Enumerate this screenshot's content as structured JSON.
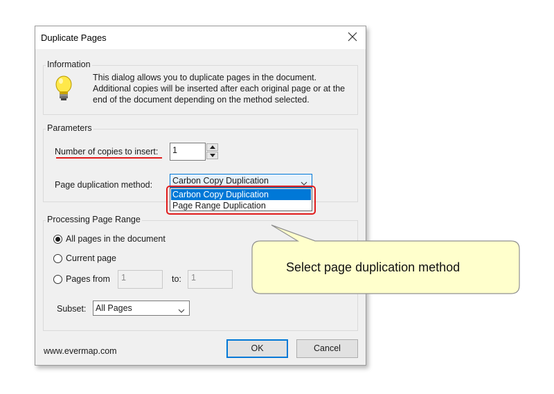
{
  "dialog": {
    "title": "Duplicate Pages",
    "close_icon": "close-icon",
    "information": {
      "legend": "Information",
      "icon": "lightbulb-icon",
      "text_line1": "This dialog allows you to duplicate pages in the document.",
      "text_line2": "Additional copies will be inserted after each original page or at the",
      "text_line3": "end of the document depending on the method selected."
    },
    "parameters": {
      "legend": "Parameters",
      "copies_label": "Number of copies to insert:",
      "copies_value": "1",
      "method_label": "Page duplication method:",
      "method_selected": "Carbon Copy Duplication",
      "method_options": [
        "Carbon Copy Duplication",
        "Page Range Duplication"
      ]
    },
    "range": {
      "legend": "Processing Page Range",
      "all_pages": "All pages in the document",
      "current_page": "Current page",
      "pages_from": "Pages from",
      "from_value": "1",
      "to_label": "to:",
      "to_value": "1",
      "subset_label": "Subset:",
      "subset_value": "All Pages"
    },
    "footer": {
      "website": "www.evermap.com",
      "ok": "OK",
      "cancel": "Cancel"
    }
  },
  "callout": {
    "text": "Select page duplication method"
  },
  "colors": {
    "accent": "#0078d7",
    "highlight_red": "#e11b1b",
    "callout_bg": "#ffffcc",
    "callout_border": "#909090"
  }
}
